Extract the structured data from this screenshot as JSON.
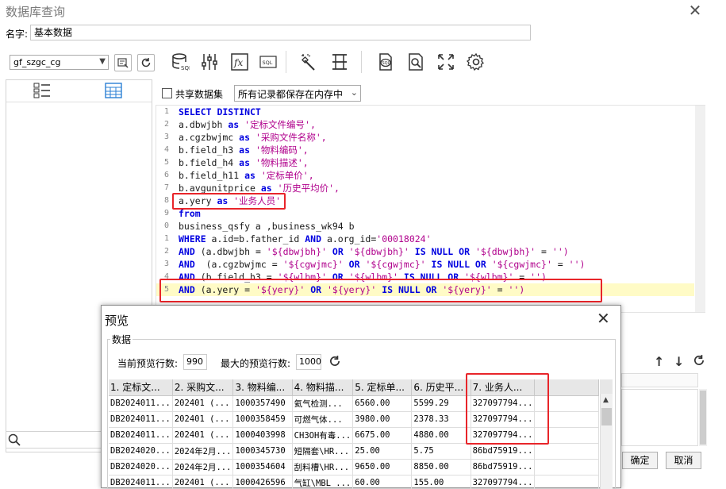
{
  "window": {
    "title": "数据库查询",
    "close": "✕"
  },
  "name_row": {
    "label": "名字:",
    "value": "基本数据"
  },
  "toolbar": {
    "datasource": "gf_szgc_cg"
  },
  "editor_opts": {
    "share_label": "共享数据集",
    "mode_value": "所有记录都保存在内存中"
  },
  "sql_lines": [
    {
      "n": "1",
      "tokens": [
        {
          "t": "SELECT DISTINCT",
          "c": "kw"
        }
      ]
    },
    {
      "n": "2",
      "tokens": [
        {
          "t": "a.dbwjbh ",
          "c": "plain"
        },
        {
          "t": "as",
          "c": "kw"
        },
        {
          "t": " '定标文件编号',",
          "c": "str"
        }
      ]
    },
    {
      "n": "3",
      "tokens": [
        {
          "t": "a.cgzbwjmc ",
          "c": "plain"
        },
        {
          "t": "as",
          "c": "kw"
        },
        {
          "t": " '采购文件名称',",
          "c": "str"
        }
      ]
    },
    {
      "n": "4",
      "tokens": [
        {
          "t": "b.field_h3 ",
          "c": "plain"
        },
        {
          "t": "as",
          "c": "kw"
        },
        {
          "t": " '物料编码',",
          "c": "str"
        }
      ]
    },
    {
      "n": "5",
      "tokens": [
        {
          "t": "b.field_h4 ",
          "c": "plain"
        },
        {
          "t": "as",
          "c": "kw"
        },
        {
          "t": " '物料描述',",
          "c": "str"
        }
      ]
    },
    {
      "n": "6",
      "tokens": [
        {
          "t": "b.field_h11 ",
          "c": "plain"
        },
        {
          "t": "as",
          "c": "kw"
        },
        {
          "t": " '定标单价',",
          "c": "str"
        }
      ]
    },
    {
      "n": "7",
      "tokens": [
        {
          "t": "b.avgunitprice ",
          "c": "plain"
        },
        {
          "t": "as",
          "c": "kw"
        },
        {
          "t": " '历史平均价',",
          "c": "str"
        }
      ]
    },
    {
      "n": "8",
      "tokens": [
        {
          "t": "a.yery ",
          "c": "plain"
        },
        {
          "t": "as",
          "c": "kw"
        },
        {
          "t": " '业务人员'",
          "c": "str"
        }
      ]
    },
    {
      "n": "9",
      "tokens": [
        {
          "t": "from",
          "c": "kw"
        }
      ]
    },
    {
      "n": "0",
      "tokens": [
        {
          "t": "business_qsfy a ,business_wk94 b",
          "c": "plain"
        }
      ]
    },
    {
      "n": "1",
      "tokens": [
        {
          "t": "WHERE",
          "c": "kw"
        },
        {
          "t": " a.id=b.father_id ",
          "c": "plain"
        },
        {
          "t": "AND",
          "c": "kw"
        },
        {
          "t": " a.org_id=",
          "c": "plain"
        },
        {
          "t": "'00018024'",
          "c": "str"
        }
      ]
    },
    {
      "n": "2",
      "tokens": [
        {
          "t": "AND",
          "c": "kw"
        },
        {
          "t": " (a.dbwjbh = ",
          "c": "plain"
        },
        {
          "t": "'${dbwjbh}'",
          "c": "str"
        },
        {
          "t": " OR ",
          "c": "kw"
        },
        {
          "t": "'${dbwjbh}'",
          "c": "str"
        },
        {
          "t": " IS NULL OR ",
          "c": "kw"
        },
        {
          "t": "'${dbwjbh}'",
          "c": "str"
        },
        {
          "t": " = ",
          "c": "plain"
        },
        {
          "t": "'')",
          "c": "str"
        }
      ]
    },
    {
      "n": "3",
      "tokens": [
        {
          "t": "AND",
          "c": "kw"
        },
        {
          "t": "  (a.cgzbwjmc = ",
          "c": "plain"
        },
        {
          "t": "'${cgwjmc}'",
          "c": "str"
        },
        {
          "t": " OR ",
          "c": "kw"
        },
        {
          "t": "'${cgwjmc}'",
          "c": "str"
        },
        {
          "t": " IS NULL OR ",
          "c": "kw"
        },
        {
          "t": "'${cgwjmc}'",
          "c": "str"
        },
        {
          "t": " = ",
          "c": "plain"
        },
        {
          "t": "'')",
          "c": "str"
        }
      ]
    },
    {
      "n": "4",
      "tokens": [
        {
          "t": "AND",
          "c": "kw"
        },
        {
          "t": " (b.field_h3 = ",
          "c": "plain"
        },
        {
          "t": "'${wlbm}'",
          "c": "str"
        },
        {
          "t": " OR ",
          "c": "kw"
        },
        {
          "t": "'${wlbm}'",
          "c": "str"
        },
        {
          "t": " IS NULL OR ",
          "c": "kw"
        },
        {
          "t": "'${wlbm}'",
          "c": "str"
        },
        {
          "t": " = ",
          "c": "plain"
        },
        {
          "t": "'')",
          "c": "str"
        }
      ]
    },
    {
      "n": "5",
      "tokens": [
        {
          "t": "AND",
          "c": "kw"
        },
        {
          "t": " (a.yery = ",
          "c": "plain"
        },
        {
          "t": "'${yery}'",
          "c": "str"
        },
        {
          "t": " OR ",
          "c": "kw"
        },
        {
          "t": "'${yery}'",
          "c": "str"
        },
        {
          "t": " IS NULL OR ",
          "c": "kw"
        },
        {
          "t": "'${yery}'",
          "c": "str"
        },
        {
          "t": " = ",
          "c": "plain"
        },
        {
          "t": "'')",
          "c": "str"
        }
      ],
      "highlight": true
    }
  ],
  "main_buttons": {
    "ok": "确定",
    "cancel": "取消"
  },
  "preview": {
    "title": "预览",
    "close": "✕",
    "group_label": "数据",
    "cur_rows_label": "当前预览行数:",
    "cur_rows_value": "990",
    "max_rows_label": "最大的预览行数:",
    "max_rows_value": "1000",
    "columns": [
      "1. 定标文...",
      "2. 采购文...",
      "3. 物料编...",
      "4. 物料描...",
      "5. 定标单...",
      "6. 历史平...",
      "7. 业务人..."
    ],
    "rows": [
      [
        "DB2024011...",
        "202401 (...",
        "1000357490",
        "氦气检测...",
        "6560.00",
        "5599.29",
        "327097794..."
      ],
      [
        "DB2024011...",
        "202401 (...",
        "1000358459",
        "可燃气体...",
        "3980.00",
        "2378.33",
        "327097794..."
      ],
      [
        "DB2024011...",
        "202401 (...",
        "1000403998",
        "CH3OH有毒...",
        "6675.00",
        "4880.00",
        "327097794..."
      ],
      [
        "DB2024020...",
        "2024年2月...",
        "1000345730",
        "短隔套\\HR...",
        "25.00",
        "5.75",
        "86bd75919..."
      ],
      [
        "DB2024020...",
        "2024年2月...",
        "1000354604",
        "刮料槽\\HR...",
        "9650.00",
        "8850.00",
        "86bd75919..."
      ],
      [
        "DB2024011...",
        "202401 (...",
        "1000426596",
        "气缸\\MBL ...",
        "60.00",
        "155.00",
        "327097794..."
      ]
    ]
  },
  "colors": {
    "keyword": "#0000e0",
    "string": "#b0008c",
    "highlight_line": "#fffbc6",
    "annotation": "#e8252a"
  },
  "icons": [
    "datasource-edit-icon",
    "refresh-icon",
    "db-sql-icon",
    "sliders-icon",
    "fx-icon",
    "sql-badge-icon",
    "magic-wand-icon",
    "split-icon",
    "sql-file-icon",
    "search-doc-icon",
    "expand-icon",
    "gear-icon",
    "list-view-icon",
    "grid-view-icon",
    "search-icon",
    "up-arrow-icon",
    "down-arrow-icon"
  ]
}
